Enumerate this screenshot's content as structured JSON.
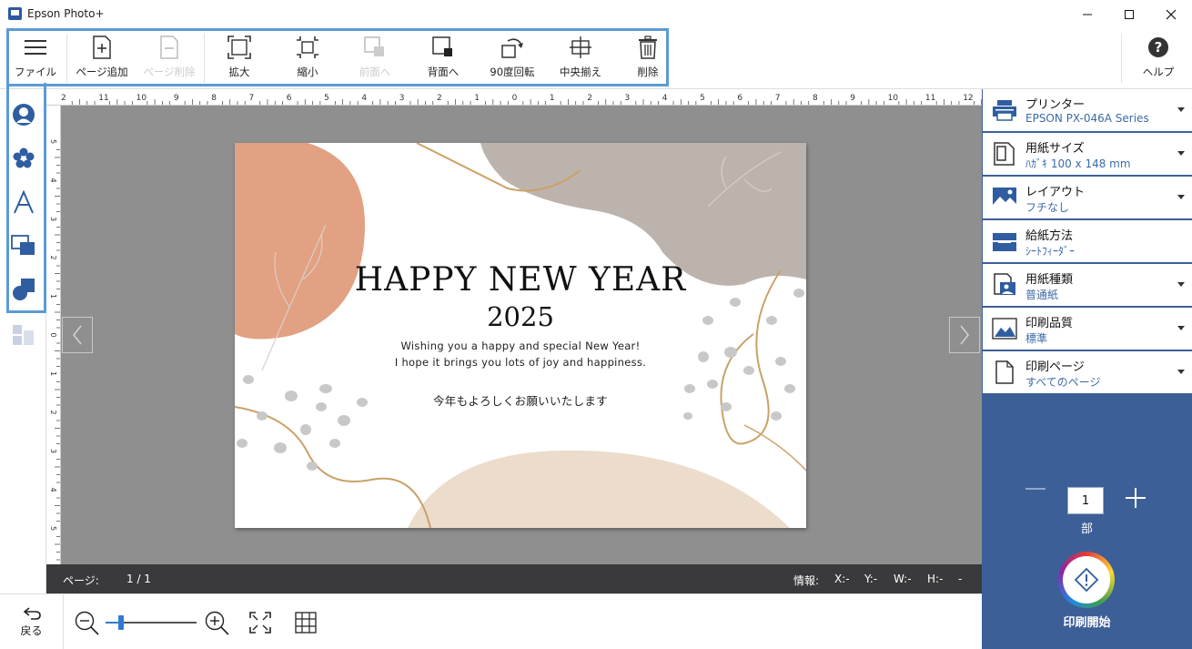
{
  "window": {
    "title": "Epson Photo+"
  },
  "toolbar": {
    "file": "ファイル",
    "add_page": "ページ追加",
    "delete_page": "ページ削除",
    "enlarge": "拡大",
    "shrink": "縮小",
    "bring_front": "前面へ",
    "send_back": "背面へ",
    "rotate": "90度回転",
    "center": "中央揃え",
    "delete": "削除",
    "help": "ヘルプ"
  },
  "card": {
    "title": "HAPPY NEW YEAR",
    "year": "2025",
    "message_line1": "Wishing you a happy and special New Year!",
    "message_line2": "I hope it brings you lots of joy and happiness.",
    "message_jp": "今年もよろしくお願いいたします"
  },
  "ruler": {
    "top_labels": [
      "2",
      "11",
      "10",
      "9",
      "8",
      "7",
      "6",
      "5",
      "4",
      "3",
      "2",
      "1",
      "0",
      "1",
      "2",
      "3",
      "4",
      "5",
      "6",
      "7",
      "8",
      "9",
      "10",
      "11",
      "12"
    ],
    "left_labels": [
      "5",
      "4",
      "3",
      "2",
      "1",
      "0",
      "1",
      "2",
      "3",
      "4",
      "5"
    ]
  },
  "status": {
    "page_label": "ページ:",
    "page_value": "1 / 1",
    "info_label": "情報:",
    "x": "X:-",
    "y": "Y:-",
    "w": "W:-",
    "h": "H:-",
    "end": "-"
  },
  "bottom": {
    "back": "戻る",
    "zoom_level": 0.17
  },
  "settings": [
    {
      "label": "プリンター",
      "value": "EPSON PX-046A Series",
      "icon": "printer-icon",
      "has_dropdown": true
    },
    {
      "label": "用紙サイズ",
      "value": "ﾊｶﾞｷ 100 x 148 mm",
      "icon": "paper-size-icon",
      "has_dropdown": true
    },
    {
      "label": "レイアウト",
      "value": "フチなし",
      "icon": "layout-icon",
      "has_dropdown": true
    },
    {
      "label": "給紙方法",
      "value": "ｼｰﾄﾌｨｰﾀﾞｰ",
      "icon": "paper-feed-icon",
      "has_dropdown": false
    },
    {
      "label": "用紙種類",
      "value": "普通紙",
      "icon": "paper-type-icon",
      "has_dropdown": true
    },
    {
      "label": "印刷品質",
      "value": "標準",
      "icon": "print-quality-icon",
      "has_dropdown": true
    },
    {
      "label": "印刷ページ",
      "value": "すべてのページ",
      "icon": "print-pages-icon",
      "has_dropdown": true
    }
  ],
  "print": {
    "copies": "1",
    "copies_unit": "部",
    "start_label": "印刷開始"
  },
  "colors": {
    "panel_blue": "#3d5f97",
    "highlight": "#5b9bd5",
    "accent_text": "#3d6aa8"
  }
}
